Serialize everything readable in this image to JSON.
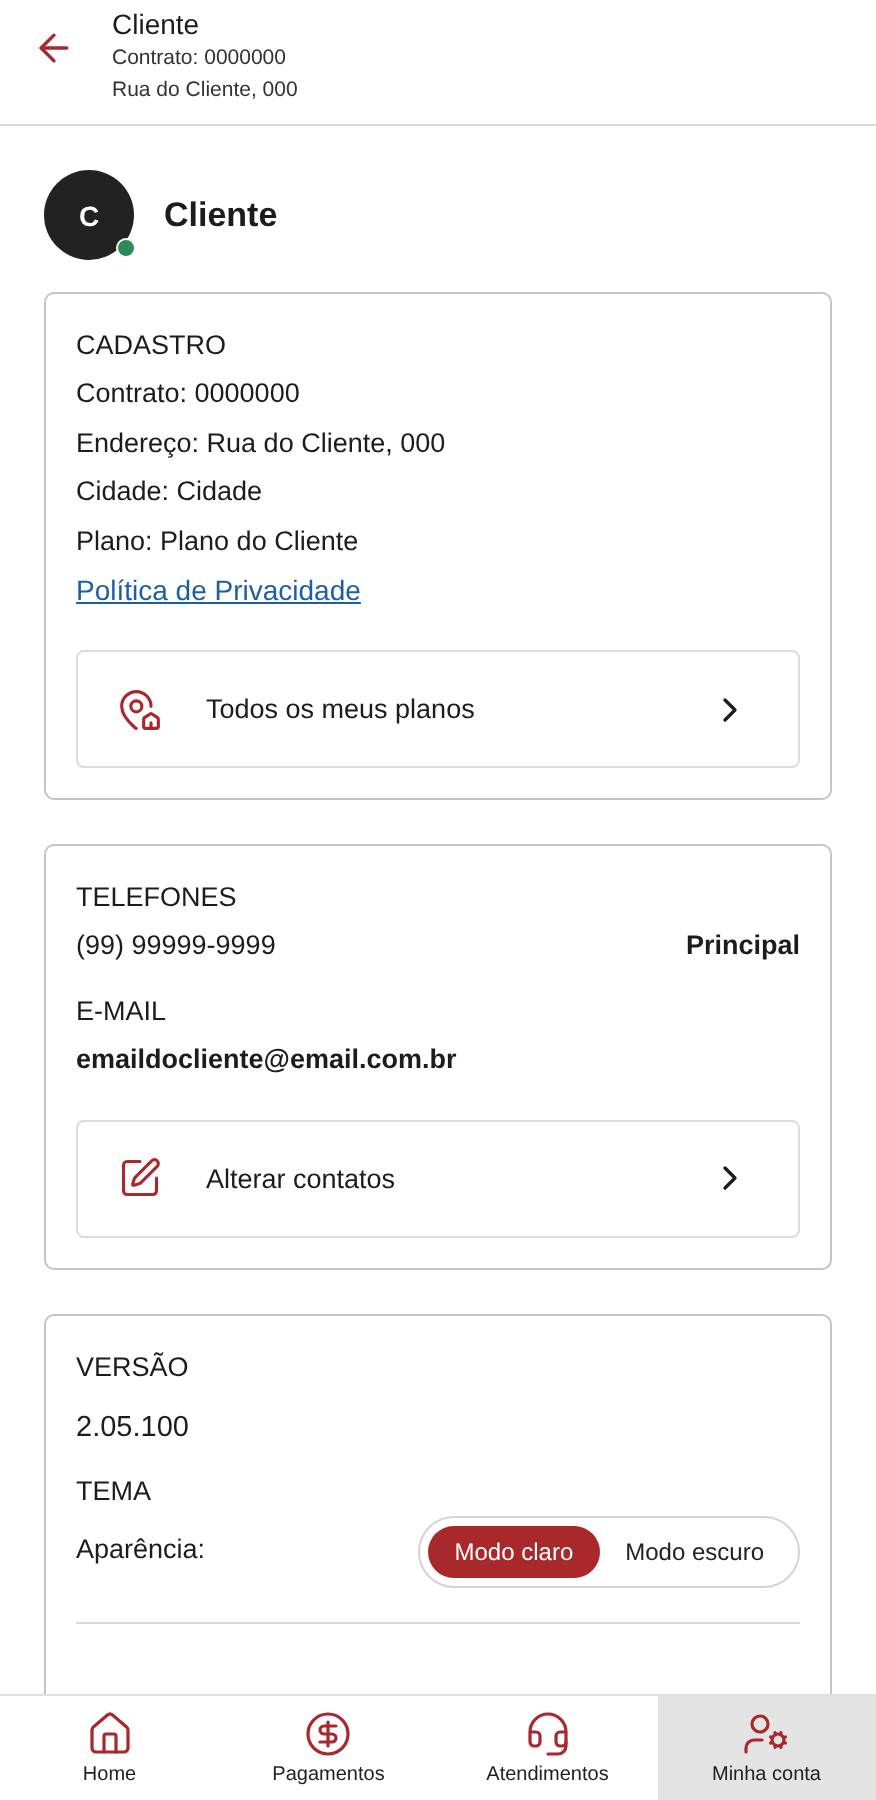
{
  "header": {
    "title": "Cliente",
    "lines": [
      "Contrato: 0000000",
      "Rua do Cliente, 000"
    ]
  },
  "profile": {
    "initial": "C",
    "name": "Cliente",
    "online": true
  },
  "cadastro": {
    "heading": "CADASTRO",
    "lines": [
      "Contrato: 0000000",
      "Endereço: Rua do Cliente, 000",
      "Cidade: Cidade",
      "Plano: Plano do Cliente"
    ],
    "link": "Política de Privacidade ",
    "action": "Todos os meus planos"
  },
  "contacts": {
    "phone_heading": "TELEFONES",
    "phone": "(99) 99999-9999",
    "phone_tag": "Principal",
    "email_heading": "E-MAIL",
    "email": "emaildocliente@email.com.br",
    "action": "Alterar contatos"
  },
  "settings": {
    "version_heading": "VERSÃO",
    "version": "2.05.100",
    "theme_heading": "TEMA",
    "appearance_label": "Aparência:",
    "modes": [
      {
        "label": "Modo claro",
        "selected": true
      },
      {
        "label": "Modo escuro",
        "selected": false
      }
    ]
  },
  "nav": [
    {
      "label": "Home",
      "selected": false
    },
    {
      "label": "Pagamentos",
      "selected": false
    },
    {
      "label": "Atendimentos",
      "selected": false
    },
    {
      "label": "Minha conta",
      "selected": true
    }
  ]
}
